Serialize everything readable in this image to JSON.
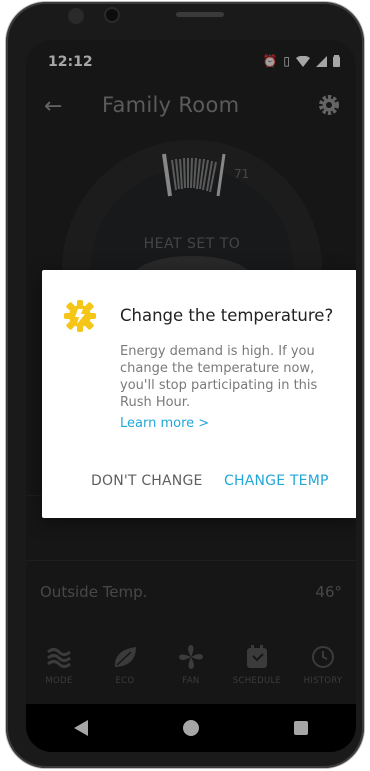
{
  "status_bar": {
    "time": "12:12"
  },
  "app_bar": {
    "title": "Family Room"
  },
  "dial": {
    "current_temp_label": "71",
    "mode_label": "HEAT SET TO"
  },
  "rows": [
    {
      "label": "",
      "value": ""
    },
    {
      "label": "Outside Temp.",
      "value": "46°"
    }
  ],
  "bottom_nav": {
    "items": [
      {
        "label": "MODE",
        "icon": "mode-icon"
      },
      {
        "label": "ECO",
        "icon": "leaf-icon"
      },
      {
        "label": "FAN",
        "icon": "fan-icon"
      },
      {
        "label": "SCHEDULE",
        "icon": "calendar-icon"
      },
      {
        "label": "HISTORY",
        "icon": "history-icon"
      }
    ]
  },
  "dialog": {
    "title": "Change the temperature?",
    "body": "Energy demand is high. If you change the temperature now, you'll stop participating in this Rush Hour.",
    "link": "Learn more >",
    "cancel_label": "DON'T CHANGE",
    "confirm_label": "CHANGE TEMP",
    "icon": "rush-hour-icon",
    "icon_color": "#f5c518",
    "accent_color": "#22a7d8"
  }
}
